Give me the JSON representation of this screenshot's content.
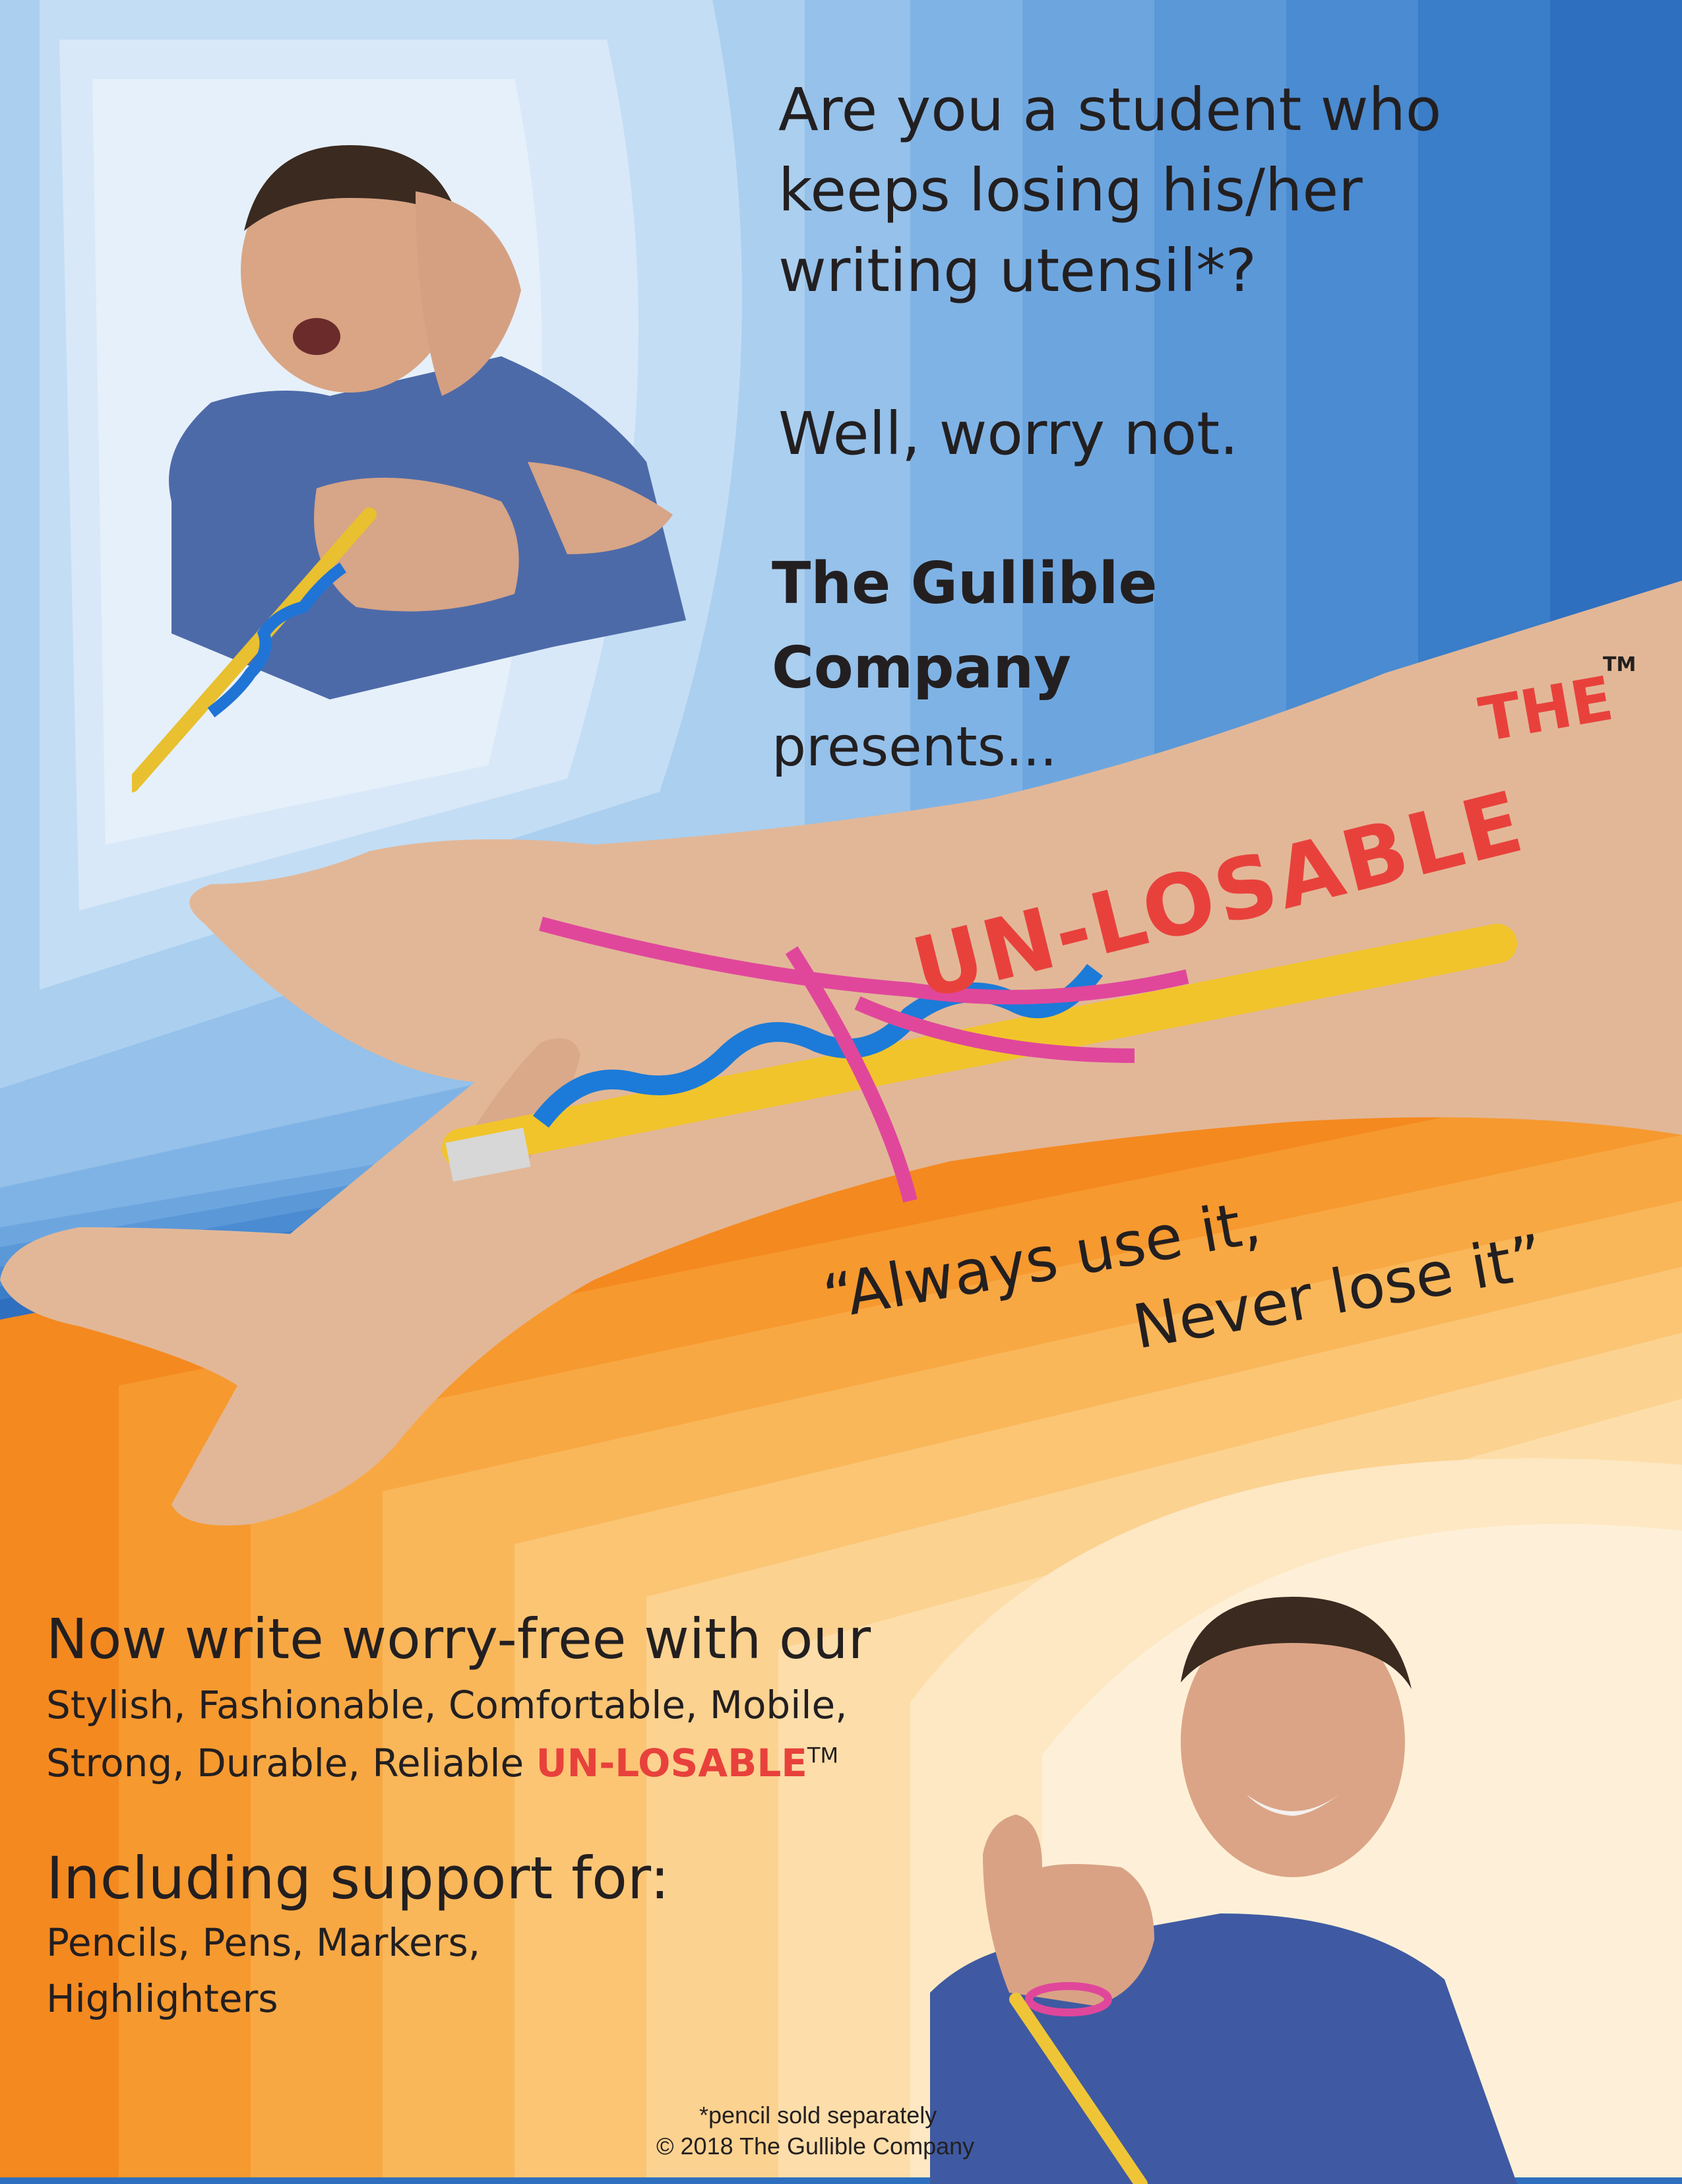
{
  "intro": {
    "question_lines": [
      "Are you a student who",
      "keeps losing his/her",
      "writing utensil*?"
    ],
    "reassure": "Well, worry not.",
    "company_lines": [
      "The Gullible",
      "Company"
    ],
    "presents": "presents..."
  },
  "product": {
    "the": "THE",
    "tm": "TM",
    "name": "UN-LOSABLE"
  },
  "slogan": {
    "line1": "“Always use it,",
    "line2": "Never lose it”"
  },
  "features": {
    "headline": "Now write worry-free with our",
    "line1": "Stylish, Fashionable, Comfortable, Mobile,",
    "line2_prefix": "Strong, Durable, Reliable ",
    "line2_brand": "UN-LOSABLE",
    "line2_tm": "TM"
  },
  "support": {
    "headline": "Including support for:",
    "line1": "Pencils, Pens, Markers,",
    "line2": "Highlighters"
  },
  "footer": {
    "note": "*pencil sold separately",
    "copyright": "© 2018 The Gullible Company"
  },
  "colors": {
    "brand_red": "#e8413c",
    "text_dark": "#231f20"
  },
  "images": {
    "top_left": "student-surprised-photo",
    "center": "hand-with-pipe-cleaner-pencil-photo",
    "bottom_right": "student-thumbs-up-photo"
  }
}
